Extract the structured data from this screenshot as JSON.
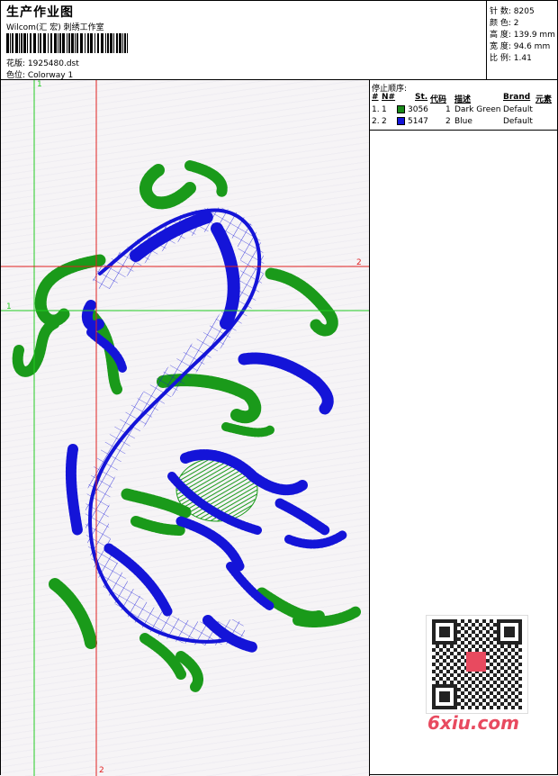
{
  "header": {
    "title": "生产作业图",
    "subtitle": "Wilcom(汇 宏) 刺绣工作室",
    "design_label": "花版: 1925480.dst",
    "colorway_label": "色位: Colorway 1"
  },
  "stats": [
    {
      "label": "针 数:",
      "value": "8205"
    },
    {
      "label": "颜 色:",
      "value": "2"
    },
    {
      "label": "高 度:",
      "value": "139.9 mm"
    },
    {
      "label": "宽 度:",
      "value": "94.6 mm"
    },
    {
      "label": "比 例:",
      "value": "1.41"
    }
  ],
  "stop_sequence": {
    "title": "停止顺序:",
    "columns": [
      "#",
      "N#",
      "St.",
      "代码",
      "描述",
      "Brand",
      "元素"
    ],
    "rows": [
      {
        "index": "1.",
        "n": "1",
        "stitches": "3056",
        "code": "1",
        "description": "Dark Green",
        "brand": "Default",
        "color": "#1a8a1a"
      },
      {
        "index": "2.",
        "n": "2",
        "stitches": "5147",
        "code": "2",
        "description": "Blue",
        "brand": "Default",
        "color": "#1414d8"
      }
    ]
  },
  "guides": {
    "green_label": "1",
    "red_label": "2",
    "green_color": "#22cc22",
    "red_color": "#e02020"
  },
  "watermark": "6xiu.com",
  "colors": {
    "thread_green": "#1a9a1a",
    "thread_blue": "#1414d8"
  }
}
